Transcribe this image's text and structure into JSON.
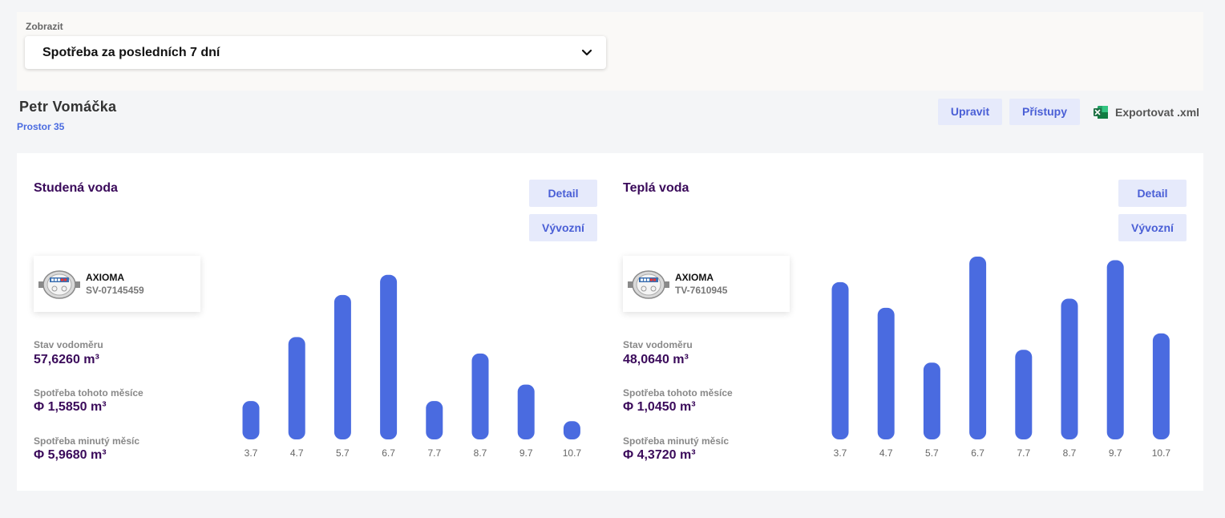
{
  "filter": {
    "label": "Zobrazit",
    "selected": "Spotřeba za posledních 7 dní"
  },
  "owner": {
    "name": "Petr Vomáčka",
    "space": "Prostor 35"
  },
  "actions": {
    "edit": "Upravit",
    "access": "Přístupy",
    "export": "Exportovat .xml"
  },
  "colors": {
    "bar": "#4a6be0",
    "accent_text": "#3a0a5a",
    "button_bg": "#e6eafb",
    "excel_green": "#1d7044"
  },
  "cold": {
    "title": "Studená voda",
    "detail": "Detail",
    "export": "Vývozní",
    "device_brand": "AXIOMA",
    "device_serial": "SV-07145459",
    "state_label": "Stav vodoměru",
    "state_value": "57,6260 m³",
    "this_month_label": "Spotřeba tohoto měsíce",
    "this_month_value": "Φ 1,5850 m³",
    "last_month_label": "Spotřeba minutý měsíc",
    "last_month_value": "Φ 5,9680 m³"
  },
  "hot": {
    "title": "Teplá voda",
    "detail": "Detail",
    "export": "Vývozní",
    "device_brand": "AXIOMA",
    "device_serial": "TV-7610945",
    "state_label": "Stav vodoměru",
    "state_value": "48,0640 m³",
    "this_month_label": "Spotřeba tohoto měsíce",
    "this_month_value": "Φ 1,0450 m³",
    "last_month_label": "Spotřeba minutý měsíc",
    "last_month_value": "Φ 4,3720 m³"
  },
  "chart_data": [
    {
      "type": "bar",
      "categories": [
        "3.7",
        "4.7",
        "5.7",
        "6.7",
        "7.7",
        "8.7",
        "9.7",
        "10.7"
      ],
      "values": [
        0.21,
        0.56,
        0.79,
        0.9,
        0.21,
        0.47,
        0.3,
        0.1
      ],
      "ylim": [
        0,
        1
      ]
    },
    {
      "type": "bar",
      "categories": [
        "3.7",
        "4.7",
        "5.7",
        "6.7",
        "7.7",
        "8.7",
        "9.7",
        "10.7"
      ],
      "values": [
        0.86,
        0.72,
        0.42,
        1.0,
        0.49,
        0.77,
        0.98,
        0.58
      ],
      "ylim": [
        0,
        1
      ]
    }
  ]
}
